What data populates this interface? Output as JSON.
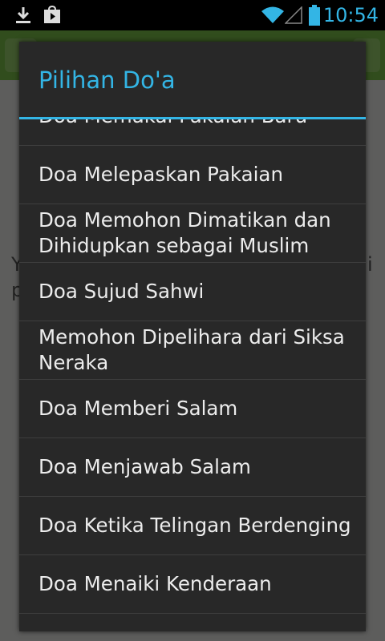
{
  "status_bar": {
    "time": "10:54",
    "icons": [
      "download-icon",
      "store-icon",
      "wifi-icon",
      "signal-icon",
      "battery-icon"
    ]
  },
  "background": {
    "text_lines": [
      "Y",
      "p"
    ],
    "text_right": [
      "i"
    ]
  },
  "dialog": {
    "title": "Pilihan Do'a",
    "accent_color": "#33b5e5",
    "items": [
      {
        "label": "Doa Memakai Pakaian Baru"
      },
      {
        "label": "Doa Melepaskan Pakaian"
      },
      {
        "label": "Doa Memohon Dimatikan dan Dihidupkan sebagai Muslim"
      },
      {
        "label": "Doa Sujud Sahwi"
      },
      {
        "label": "Memohon Dipelihara dari Siksa Neraka"
      },
      {
        "label": "Doa Memberi Salam"
      },
      {
        "label": "Doa Menjawab Salam"
      },
      {
        "label": "Doa Ketika Telingan Berdenging"
      },
      {
        "label": "Doa Menaiki Kenderaan"
      }
    ]
  }
}
